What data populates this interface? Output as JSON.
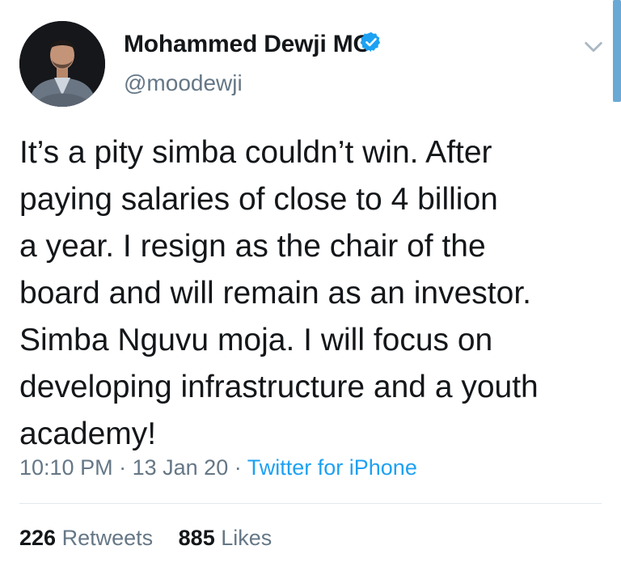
{
  "tweet": {
    "author": {
      "display_name": "Mohammed Dewji MO",
      "handle": "@moodewji",
      "verified_icon": "verified-badge-icon",
      "avatar": "profile-photo"
    },
    "text": "It’s a pity simba couldn’t win. After\npaying salaries of close to 4 billion\na year. I resign as the chair of the\nboard and will remain as an investor.\nSimba Nguvu moja. I will focus on\ndeveloping infrastructure and a youth\nacademy!",
    "time": "10:10 PM",
    "date": "13 Jan 20",
    "separator": "·",
    "source": "Twitter for iPhone",
    "stats": {
      "retweets_count": "226",
      "retweets_label": "Retweets",
      "likes_count": "885",
      "likes_label": "Likes"
    },
    "menu_icon": "chevron-down-icon"
  },
  "colors": {
    "text": "#14171a",
    "secondary": "#657786",
    "link": "#1da1f2",
    "verified": "#1da1f2",
    "divider": "#e1e8ed"
  }
}
